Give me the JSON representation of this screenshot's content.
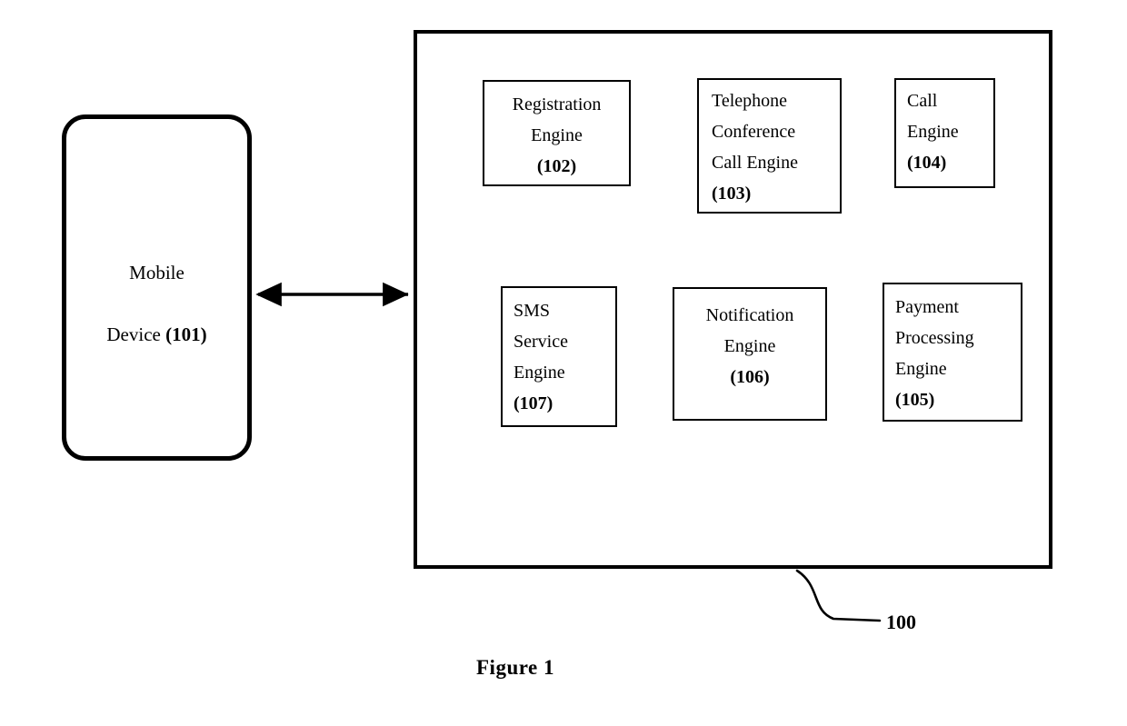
{
  "figure": {
    "caption": "Figure 1",
    "system_reference_numeral": "100"
  },
  "device": {
    "name": "mobile-device",
    "line1": "Mobile",
    "line2_text": "Device ",
    "line2_ref": "(101)",
    "reference_numeral": "101"
  },
  "system": {
    "name": "telephone-conference-system",
    "reference_numeral": "100",
    "engines": [
      {
        "id": "102",
        "name": "registration-engine",
        "lines": [
          "Registration",
          "Engine"
        ],
        "ref": "(102)",
        "align": "center"
      },
      {
        "id": "103",
        "name": "telephone-conference-call-engine",
        "lines": [
          "Telephone",
          "Conference",
          "Call Engine"
        ],
        "ref": "(103)",
        "align": "left"
      },
      {
        "id": "104",
        "name": "call-engine",
        "lines": [
          "Call",
          "Engine"
        ],
        "ref": "(104)",
        "align": "left"
      },
      {
        "id": "105",
        "name": "payment-processing-engine",
        "lines": [
          "Payment",
          "Processing",
          "Engine"
        ],
        "ref": "(105)",
        "align": "left"
      },
      {
        "id": "106",
        "name": "notification-engine",
        "lines": [
          "Notification",
          "Engine"
        ],
        "ref": "(106)",
        "align": "center"
      },
      {
        "id": "107",
        "name": "sms-service-engine",
        "lines": [
          "SMS",
          "Service",
          "Engine"
        ],
        "ref": "(107)",
        "align": "left"
      }
    ],
    "connections": [
      {
        "from": "101",
        "to": "100",
        "type": "bidirectional",
        "orientation": "horizontal"
      },
      {
        "from": "102",
        "to": "103",
        "type": "bidirectional",
        "orientation": "horizontal"
      },
      {
        "from": "103",
        "to": "104",
        "type": "bidirectional",
        "orientation": "horizontal"
      },
      {
        "from": "104",
        "to": "105",
        "type": "bidirectional",
        "orientation": "vertical"
      },
      {
        "from": "105",
        "to": "106",
        "type": "bidirectional",
        "orientation": "horizontal"
      },
      {
        "from": "106",
        "to": "107",
        "type": "bidirectional",
        "orientation": "horizontal"
      }
    ]
  },
  "text": {
    "box_102": "Registration\nEngine\n(102)",
    "box_103": "Telephone\nConference\nCall Engine\n(103)",
    "box_104": "Call\nEngine\n(104)",
    "box_105": "Payment\nProcessing\nEngine\n(105)",
    "box_106": "Notification\nEngine\n(106)",
    "box_107": "SMS\nService\nEngine\n(107)"
  },
  "colors": {
    "stroke": "#000000",
    "background": "#ffffff"
  }
}
